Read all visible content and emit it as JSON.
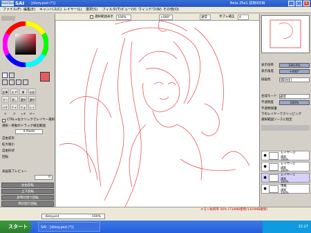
{
  "title_bar": {
    "logo_text": "PaintTool",
    "app_name": "SAI",
    "document": "- [dizzy.psd (*)]",
    "version_text": "Beta 25e1 試用9日目",
    "minimize": "_",
    "maximize": "□",
    "close": "×"
  },
  "menu": [
    "ファイル(F)",
    "編集(E)",
    "キャンバス(C)",
    "レイヤー(L)",
    "選択(S)",
    "フィルタ(T)",
    "ビュー(V)",
    "ウィンドウ(W)",
    "その他(O)"
  ],
  "toolbar": {
    "select_label": "選択範囲表示",
    "zoom": "100%",
    "angle": "+000°",
    "mode": "通常",
    "stabilizer_label": "手ブレ補正",
    "stabilizer_value": "4"
  },
  "left_panel": {
    "tool_grid": [
      "鉛筆",
      "エアブラシ",
      "筆",
      "水彩筆",
      "マーカー",
      "消しゴム",
      "選択ペン",
      "選択消し",
      "バケツ",
      "ナイフ",
      "ウォッチ",
      "レイヤー"
    ],
    "ctrl_label": "CTRL+左クリックでレイヤー選択",
    "drag_label": "選択・移動のドラッグ検出範囲",
    "drag_value": "4 Pixels",
    "free_transform": "自由変形",
    "scale": "拡大縮小",
    "free_shape": "自由形状",
    "rotate": "回転",
    "hq_preview": "高画質プレビュー",
    "rotation_angle": "0",
    "buttons": [
      "左右反転",
      "上下反転",
      "反時計回り回転",
      "時計回り回転"
    ]
  },
  "right_panel": {
    "opacity_label": "表示倍率",
    "opacity_value": "100.0%",
    "rotation_label": "表示角度",
    "rotation_value": "+000°",
    "blend_label": "描画色",
    "blend_value": "[無効化]",
    "mode_label": "合成モード",
    "mode_value": "通常",
    "opacity2_label": "不透明度",
    "opacity2_value": "100%",
    "checks": [
      "不透明保護",
      "下のレイヤーでクリッピング",
      "選択範囲ソースに指定"
    ],
    "layers": [
      {
        "name": "レイヤー3",
        "mode": "通常",
        "opacity": "100%"
      },
      {
        "name": "レイヤー2",
        "mode": "通常",
        "opacity": "100%"
      },
      {
        "name": "レイヤー1",
        "mode": "通常",
        "opacity": "100%"
      },
      {
        "name": "用紙",
        "mode": "通常",
        "opacity": "100%"
      }
    ]
  },
  "status": {
    "doc_name": "dizzy.psd",
    "doc_zoom": "100%",
    "memory": "メモリ負荷率 56% (734MB使用/1310MB確保)"
  },
  "taskbar": {
    "start": "スタート",
    "task": "SAI - [dizzy.psd (*)]",
    "clock": "22:27"
  },
  "colors": {
    "title": "#2557c7",
    "sketch": "#e0383c",
    "selected_color": "#e85a63",
    "taskbar": "#245edb"
  }
}
